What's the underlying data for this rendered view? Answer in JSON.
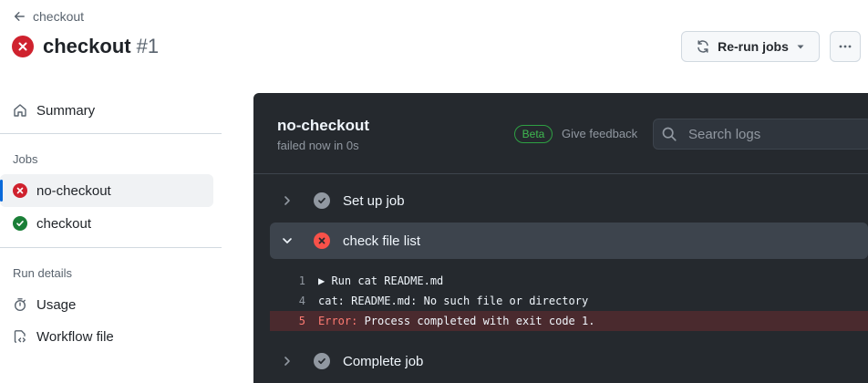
{
  "header": {
    "back_label": "checkout",
    "title": "checkout",
    "run_number": "#1",
    "rerun_label": "Re-run jobs"
  },
  "sidebar": {
    "summary_label": "Summary",
    "jobs_heading": "Jobs",
    "jobs": [
      {
        "label": "no-checkout",
        "status": "failed"
      },
      {
        "label": "checkout",
        "status": "success"
      }
    ],
    "run_details_heading": "Run details",
    "usage_label": "Usage",
    "workflow_file_label": "Workflow file"
  },
  "log_panel": {
    "job_name": "no-checkout",
    "job_status": "failed now in 0s",
    "beta_label": "Beta",
    "feedback_label": "Give feedback",
    "search_placeholder": "Search logs",
    "steps": [
      {
        "label": "Set up job",
        "status": "success",
        "expanded": false
      },
      {
        "label": "check file list",
        "status": "failed",
        "expanded": true
      },
      {
        "label": "Complete job",
        "status": "success",
        "expanded": false
      }
    ],
    "log_lines": [
      {
        "num": "1",
        "prefix": "▶ ",
        "text": "Run cat README.md"
      },
      {
        "num": "4",
        "text": "cat: README.md: No such file or directory"
      },
      {
        "num": "5",
        "error_word": "Error:",
        "text": " Process completed with exit code 1."
      }
    ]
  },
  "colors": {
    "failed": "#cf222e",
    "success": "#1a7f37",
    "panel_bg": "#25292e",
    "accent": "#0969da"
  }
}
